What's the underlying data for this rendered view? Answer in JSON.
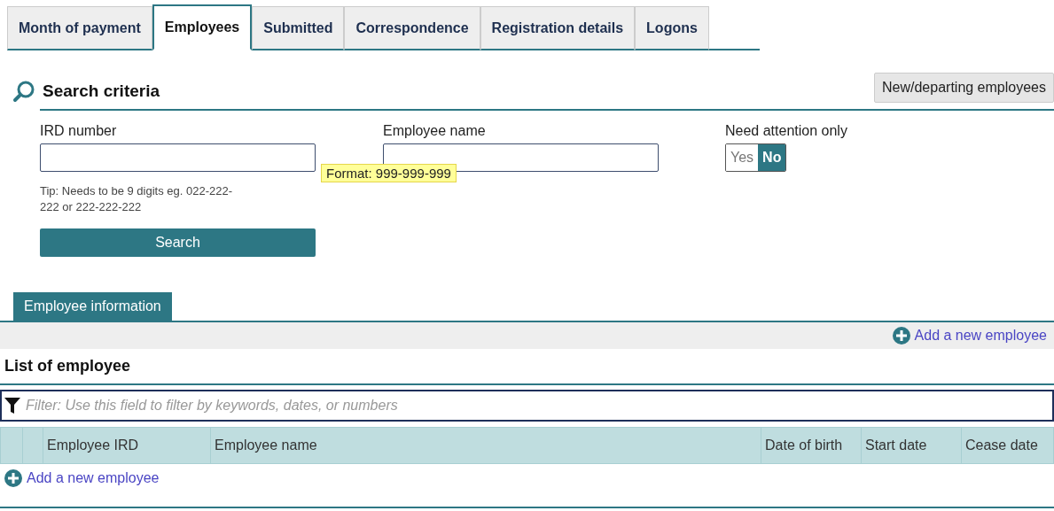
{
  "tabs": [
    {
      "label": "Month of payment",
      "selected": false
    },
    {
      "label": "Employees",
      "selected": true
    },
    {
      "label": "Submitted",
      "selected": false
    },
    {
      "label": "Correspondence",
      "selected": false
    },
    {
      "label": "Registration details",
      "selected": false
    },
    {
      "label": "Logons",
      "selected": false
    }
  ],
  "search": {
    "title": "Search criteria",
    "action": "New/departing employees",
    "ird": {
      "label": "IRD number",
      "tooltip": "Format: 999-999-999",
      "tip": "Tip: Needs to be 9 digits eg. 022-222-222 or 222-222-222"
    },
    "name": {
      "label": "Employee name"
    },
    "attention": {
      "label": "Need attention only",
      "options": [
        {
          "label": "Yes",
          "selected": false
        },
        {
          "label": "No",
          "selected": true
        }
      ]
    },
    "button": "Search"
  },
  "section_tab": "Employee information",
  "add_link_top": "Add a new employee",
  "list": {
    "title": "List of employee",
    "filter_placeholder": "Filter: Use this field to filter by keywords, dates, or numbers",
    "columns": [
      "Employee IRD",
      "Employee name",
      "Date of birth",
      "Start date",
      "Cease date"
    ],
    "add_link": "Add a new employee"
  }
}
